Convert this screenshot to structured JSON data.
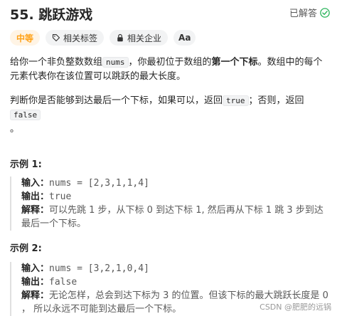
{
  "problem": {
    "title": "55. 跳跃游戏",
    "status": "已解答",
    "difficulty": "中等",
    "tags": [
      "相关标签",
      "相关企业"
    ],
    "font_toggle": "Aa"
  },
  "description": {
    "p1_a": "给你一个非负整数数组",
    "p1_code": "nums",
    "p1_b": "，你最初位于数组的",
    "p1_bold": "第一个下标",
    "p1_c": "。数组中的每个元素代表你在该位置可以跳跃的最大长度。",
    "p2_a": "判断你是否能够到达最后一个下标，如果可以，返回",
    "p2_code1": "true",
    "p2_b": "；否则，返回",
    "p2_code2": "false",
    "p2_c": "。"
  },
  "examples": [
    {
      "title": "示例 1:",
      "input_label": "输入：",
      "input": "nums = [2,3,1,1,4]",
      "output_label": "输出：",
      "output": "true",
      "explain_label": "解释：",
      "explain": "可以先跳 1 步，从下标 0 到达下标 1, 然后再从下标 1 跳 3 步到达最后一个下标。"
    },
    {
      "title": "示例 2:",
      "input_label": "输入：",
      "input": "nums = [3,2,1,0,4]",
      "output_label": "输出：",
      "output": "false",
      "explain_label": "解释：",
      "explain": "无论怎样，总会到达下标为 3 的位置。但该下标的最大跳跃长度是 0 ， 所以永远不可能到达最后一个下标。"
    }
  ],
  "watermark": "CSDN @肥肥的远锅",
  "colors": {
    "difficulty": "#ffa116",
    "solved_check": "#2db55d"
  }
}
